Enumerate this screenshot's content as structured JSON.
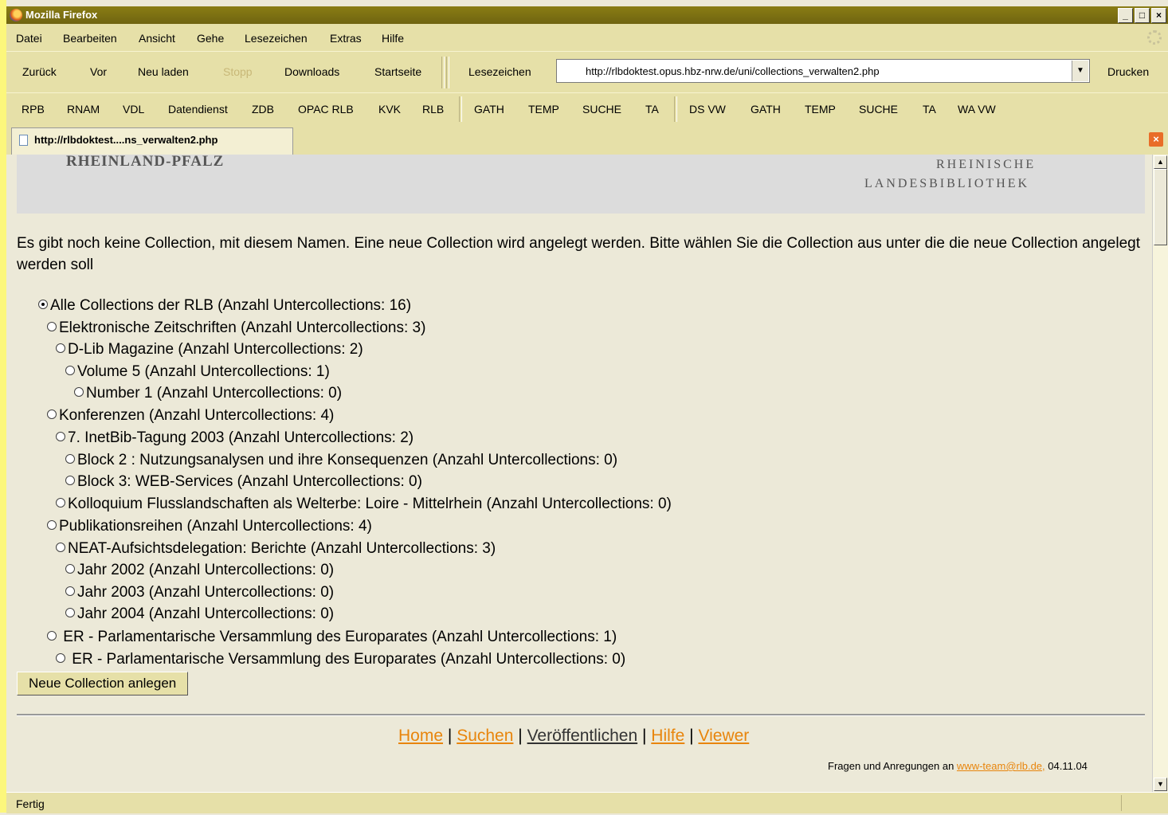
{
  "window": {
    "title": "Mozilla Firefox"
  },
  "menu": {
    "items": [
      "Datei",
      "Bearbeiten",
      "Ansicht",
      "Gehe",
      "Lesezeichen",
      "Extras",
      "Hilfe"
    ]
  },
  "nav": {
    "back": "Zurück",
    "forward": "Vor",
    "reload": "Neu laden",
    "stop": "Stopp",
    "downloads": "Downloads",
    "home": "Startseite",
    "bookmarks": "Lesezeichen",
    "url": "http://rlbdoktest.opus.hbz-nrw.de/uni/collections_verwalten2.php",
    "print": "Drucken"
  },
  "bookmarks_bar": [
    "RPB",
    "RNAM",
    "VDL",
    "Datendienst",
    "ZDB",
    "OPAC RLB",
    "KVK",
    "RLB",
    "GATH",
    "TEMP",
    "SUCHE",
    "TA",
    "DS VW",
    "GATH",
    "TEMP",
    "SUCHE",
    "TA",
    "WA VW"
  ],
  "tab": {
    "label": "http://rlbdoktest....ns_verwalten2.php"
  },
  "banner": {
    "left": "RHEINLAND-PFALZ",
    "right_line1": "RHEINISCHE",
    "right_line2": "LANDESBIBLIOTHEK"
  },
  "intro": "Es gibt noch keine Collection, mit diesem Namen. Eine neue Collection wird angelegt werden. Bitte wählen Sie die Collection aus unter die die neue Collection angelegt werden soll",
  "collections": [
    {
      "label": "Alle Collections der RLB (Anzahl Untercollections: 16)",
      "checked": true
    },
    {
      "label": "Elektronische Zeitschriften (Anzahl Untercollections: 3)",
      "checked": false
    },
    {
      "label": "D-Lib Magazine (Anzahl Untercollections: 2)",
      "checked": false
    },
    {
      "label": "Volume 5 (Anzahl Untercollections: 1)",
      "checked": false
    },
    {
      "label": "Number 1 (Anzahl Untercollections: 0)",
      "checked": false
    },
    {
      "label": "Konferenzen (Anzahl Untercollections: 4)",
      "checked": false
    },
    {
      "label": "7. InetBib-Tagung 2003 (Anzahl Untercollections: 2)",
      "checked": false
    },
    {
      "label": "Block 2 : Nutzungsanalysen und ihre Konsequenzen (Anzahl Untercollections: 0)",
      "checked": false
    },
    {
      "label": "Block 3: WEB-Services (Anzahl Untercollections: 0)",
      "checked": false
    },
    {
      "label": "Kolloquium Flusslandschaften als Welterbe: Loire - Mittelrhein (Anzahl Untercollections: 0)",
      "checked": false
    },
    {
      "label": "Publikationsreihen (Anzahl Untercollections: 4)",
      "checked": false
    },
    {
      "label": "NEAT-Aufsichtsdelegation: Berichte (Anzahl Untercollections: 3)",
      "checked": false
    },
    {
      "label": "Jahr 2002 (Anzahl Untercollections: 0)",
      "checked": false
    },
    {
      "label": "Jahr 2003 (Anzahl Untercollections: 0)",
      "checked": false
    },
    {
      "label": "Jahr 2004 (Anzahl Untercollections: 0)",
      "checked": false
    },
    {
      "label": " ER - Parlamentarische Versammlung des Europarates (Anzahl Untercollections: 1)",
      "checked": false
    },
    {
      "label": " ER - Parlamentarische Versammlung des Europarates (Anzahl Untercollections: 0)",
      "checked": false
    }
  ],
  "submit": "Neue Collection anlegen",
  "footer": {
    "links": [
      "Home",
      "Suchen",
      "Veröffentlichen",
      "Hilfe",
      "Viewer"
    ],
    "contact_text": "Fragen und Anregungen an ",
    "contact_email": "www-team@rlb.de,",
    "date": " 04.11.04"
  },
  "status": {
    "text": "Fertig"
  }
}
